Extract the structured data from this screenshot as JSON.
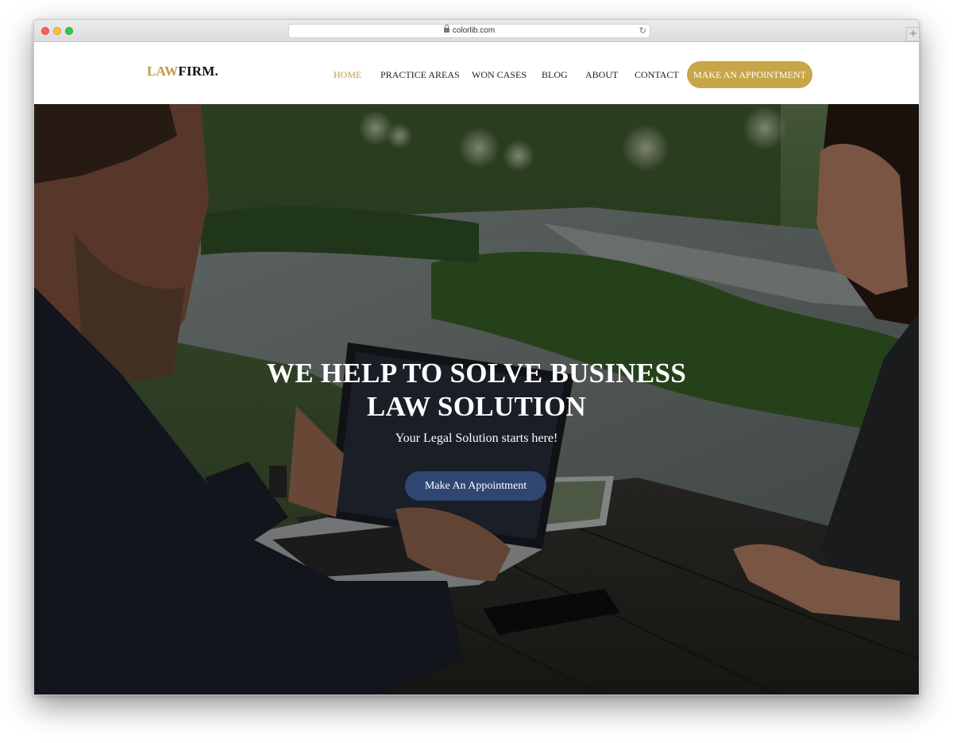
{
  "browser": {
    "url": "colorlib.com",
    "new_tab_label": "+"
  },
  "site": {
    "logo_part1": "LAW",
    "logo_part2": "FIRM."
  },
  "nav": {
    "items": [
      {
        "label": "HOME",
        "active": true
      },
      {
        "label": "PRACTICE AREAS",
        "active": false
      },
      {
        "label": "WON CASES",
        "active": false
      },
      {
        "label": "BLOG",
        "active": false
      },
      {
        "label": "ABOUT",
        "active": false
      },
      {
        "label": "CONTACT",
        "active": false
      }
    ],
    "cta_label": "MAKE AN APPOINTMENT"
  },
  "hero": {
    "title_line1": "WE HELP TO SOLVE BUSINESS",
    "title_line2": "LAW SOLUTION",
    "subtitle": "Your Legal Solution starts here!",
    "button_label": "Make An Appointment"
  },
  "colors": {
    "accent_gold": "#c6a648",
    "active_nav": "#c09b3e",
    "hero_button": "#2f4672"
  },
  "icons": {
    "lock": "lock-icon",
    "reload": "reload-icon"
  }
}
